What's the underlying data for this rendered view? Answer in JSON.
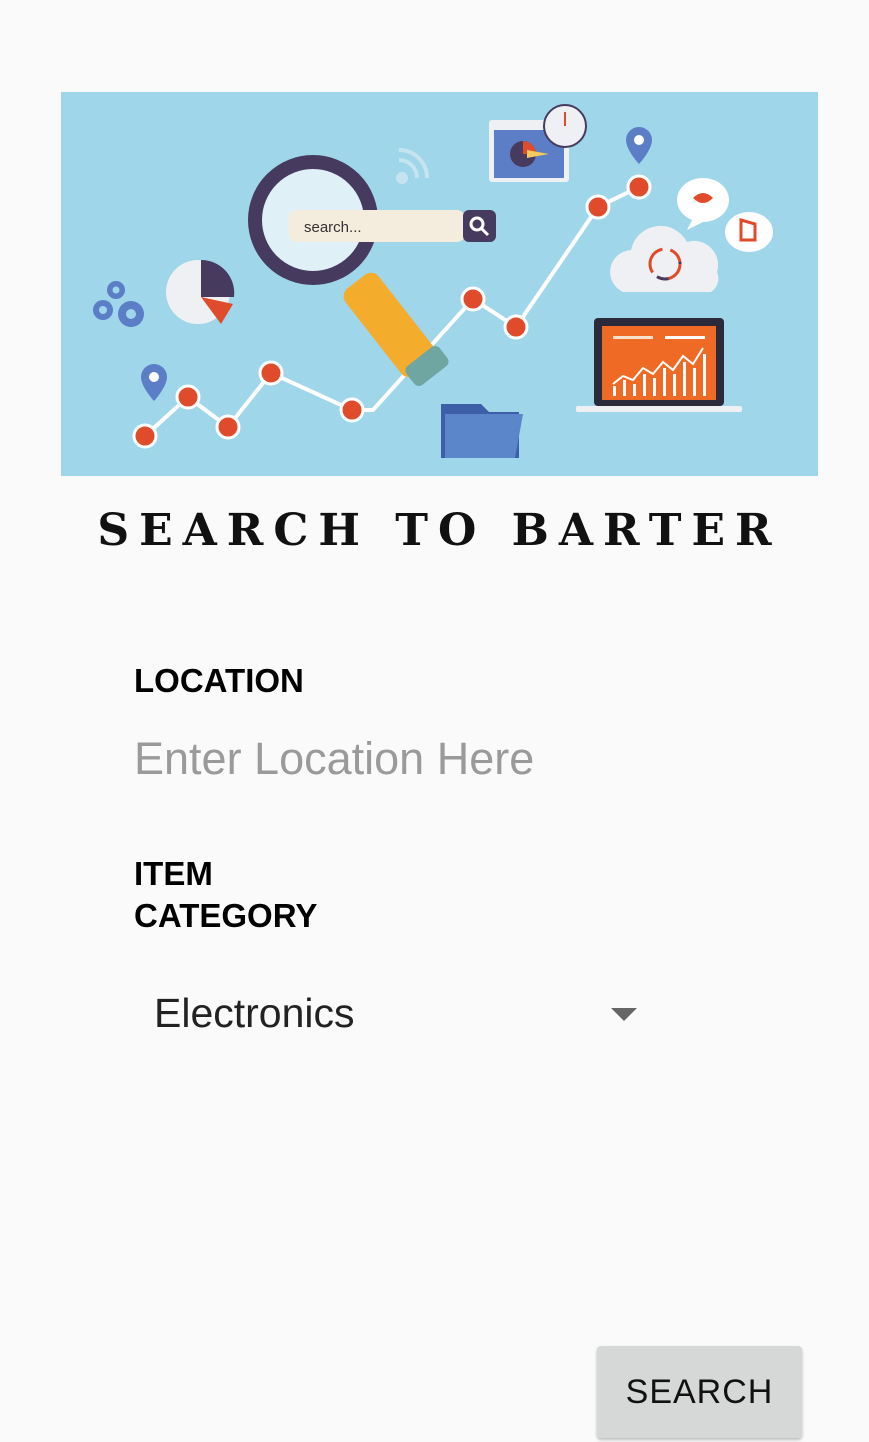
{
  "banner": {
    "search_box_text": "search...",
    "background_color": "#9fd6ea",
    "icons": [
      "magnifier-icon",
      "pie-chart-icon",
      "gear-icon",
      "map-pin-icon",
      "folder-icon",
      "laptop-icon",
      "cloud-sync-icon",
      "chat-bubble-icon",
      "wifi-icon",
      "gauge-icon"
    ]
  },
  "app_title": "SEARCH TO BARTER",
  "form": {
    "location_label": "LOCATION",
    "location_placeholder": "Enter Location Here",
    "location_value": "",
    "category_label": "ITEM\nCATEGORY",
    "category_selected": "Electronics"
  },
  "actions": {
    "search_label": "SEARCH"
  }
}
